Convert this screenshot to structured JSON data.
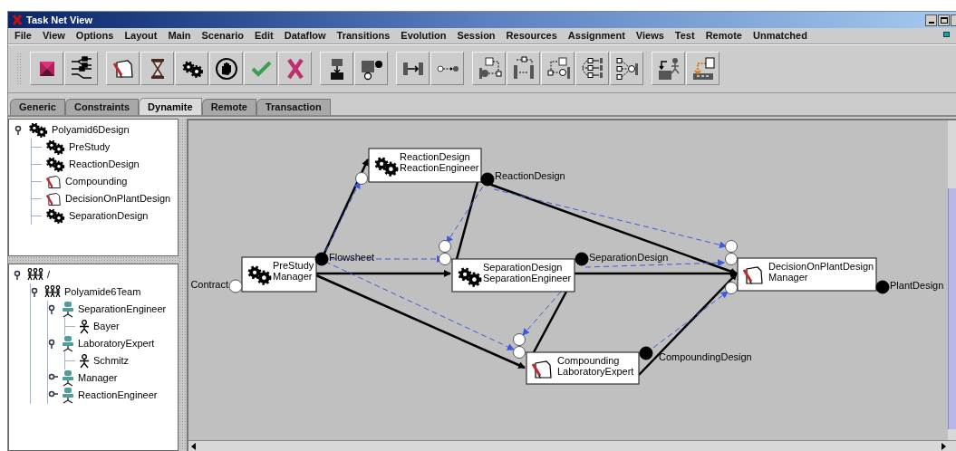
{
  "window": {
    "title": "Task Net View"
  },
  "menu": [
    "File",
    "View",
    "Options",
    "Layout",
    "Main",
    "Scenario",
    "Edit",
    "Dataflow",
    "Transitions",
    "Evolution",
    "Session",
    "Resources",
    "Assignment",
    "Views",
    "Test",
    "Remote",
    "Unmatched"
  ],
  "tabs": [
    {
      "label": "Generic",
      "selected": false
    },
    {
      "label": "Constraints",
      "selected": false
    },
    {
      "label": "Dynamite",
      "selected": true
    },
    {
      "label": "Remote",
      "selected": false
    },
    {
      "label": "Transaction",
      "selected": false
    }
  ],
  "task_tree": [
    {
      "label": "Polyamid6Design",
      "kind": "gears",
      "expanded": true,
      "children": [
        {
          "label": "PreStudy",
          "kind": "gears"
        },
        {
          "label": "ReactionDesign",
          "kind": "gears"
        },
        {
          "label": "Compounding",
          "kind": "task"
        },
        {
          "label": "DecisionOnPlantDesign",
          "kind": "task"
        },
        {
          "label": "SeparationDesign",
          "kind": "gears"
        }
      ]
    }
  ],
  "team_tree": [
    {
      "label": "/",
      "kind": "team",
      "expanded": true,
      "children": [
        {
          "label": "Polyamide6Team",
          "kind": "team",
          "expanded": true,
          "children": [
            {
              "label": "SeparationEngineer",
              "kind": "role",
              "expanded": true,
              "children": [
                {
                  "label": "Bayer",
                  "kind": "person"
                }
              ]
            },
            {
              "label": "LaboratoryExpert",
              "kind": "role",
              "expanded": true,
              "children": [
                {
                  "label": "Schmitz",
                  "kind": "person"
                }
              ]
            },
            {
              "label": "Manager",
              "kind": "role",
              "expanded": false
            },
            {
              "label": "ReactionEngineer",
              "kind": "role",
              "expanded": false
            }
          ]
        }
      ]
    }
  ],
  "diagram": {
    "nodes": [
      {
        "kind": "gears",
        "lines": [
          "PreStudy",
          "Manager"
        ]
      },
      {
        "kind": "gears",
        "lines": [
          "ReactionDesign",
          "ReactionEngineer"
        ]
      },
      {
        "kind": "gears",
        "lines": [
          "SeparationDesign",
          "SeparationEngineer"
        ]
      },
      {
        "kind": "task",
        "lines": [
          "Compounding",
          "LaboratoryExpert"
        ]
      },
      {
        "kind": "task",
        "lines": [
          "DecisionOnPlantDesign",
          "Manager"
        ]
      }
    ],
    "ports": [
      {
        "label": "Contract",
        "filled": false
      },
      {
        "label": "Flowsheet",
        "filled": true
      },
      {
        "label": "ReactionDesign",
        "filled": true
      },
      {
        "label": "SeparationDesign",
        "filled": true
      },
      {
        "label": "CompoundingDesign",
        "filled": true
      },
      {
        "label": "PlantDesign",
        "filled": true
      }
    ]
  }
}
